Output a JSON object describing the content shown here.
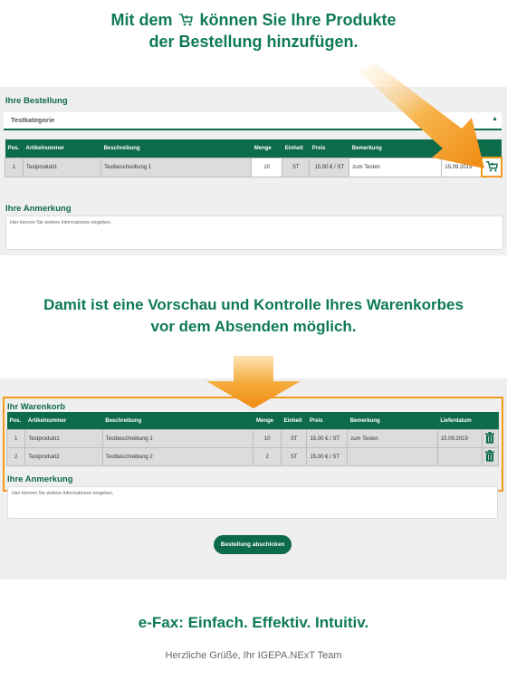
{
  "headline1": {
    "line1_pre": "Mit dem",
    "line1_post": "können Sie Ihre Produkte",
    "line2": "der Bestellung hinzufügen."
  },
  "order": {
    "title": "Ihre Bestellung",
    "category": "Testkategorie",
    "columns": [
      "Pos.",
      "Artikelnummer",
      "Beschreibung",
      "Menge",
      "Einheit",
      "Preis",
      "Bemerkung"
    ],
    "row": {
      "pos": "1",
      "article": "Testprodukt1",
      "desc": "Testbeschreibung 1",
      "qty": "10",
      "unit": "ST",
      "price": "15,00 € / ST",
      "remark": "zum Testen",
      "date": "15.09.2019"
    }
  },
  "note1": {
    "title": "Ihre Anmerkung",
    "placeholder": "Hier können Sie weitere Informationen eingeben."
  },
  "headline2": {
    "line1": "Damit ist eine Vorschau und Kontrolle Ihres Warenkorbes",
    "line2": "vor dem Absenden möglich."
  },
  "cart": {
    "title": "Ihr Warenkorb",
    "columns": [
      "Pos.",
      "Artikelnummer",
      "Beschreibung",
      "Menge",
      "Einheit",
      "Preis",
      "Bemerkung",
      "Lieferdatum"
    ],
    "rows": [
      {
        "pos": "1",
        "article": "Testprodukt1",
        "desc": "Testbeschreibung 1",
        "qty": "10",
        "unit": "ST",
        "price": "15,00 € / ST",
        "remark": "zum Testen",
        "date": "15.09.2019"
      },
      {
        "pos": "2",
        "article": "Testprodukt2",
        "desc": "Testbeschreibung 2",
        "qty": "2",
        "unit": "ST",
        "price": "15,00 € / ST",
        "remark": "",
        "date": ""
      }
    ]
  },
  "note2": {
    "title": "Ihre Anmerkung",
    "placeholder": "Hier können Sie weitere Informationen eingeben."
  },
  "submit_label": "Bestellung abschicken",
  "tagline": "e-Fax: Einfach. Effektiv. Intuitiv.",
  "footer": "Herzliche Grüße, Ihr IGEPA.NExT Team",
  "colors": {
    "brand": "#0e6b4a",
    "headline": "#0e7a54",
    "accent": "#f39a1e"
  },
  "icons": {
    "cart": "cart-add-icon",
    "trash": "trash-icon",
    "chevron": "chevron-up-icon"
  }
}
